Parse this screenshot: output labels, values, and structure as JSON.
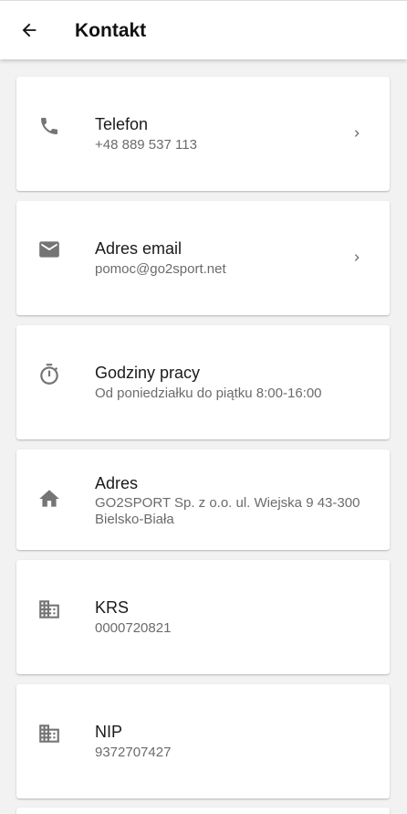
{
  "appbar": {
    "title": "Kontakt",
    "back_icon": "arrow-back-icon"
  },
  "colors": {
    "appbar_bg": "#ffffff",
    "page_bg": "#f2f2f2",
    "icon": "#757575",
    "label": "#1a1a1a",
    "secondary_text": "#6b6b6b"
  },
  "contacts": [
    {
      "label": "Telefon",
      "value": "+48 889 537 113",
      "icon": "phone-icon",
      "chevron": true
    },
    {
      "label": "Adres email",
      "value": "pomoc@go2sport.net",
      "icon": "email-icon",
      "chevron": true
    },
    {
      "label": "Godziny pracy",
      "value": "Od poniedziałku do piątku 8:00-16:00",
      "icon": "timer-icon",
      "chevron": false
    },
    {
      "label": "Adres",
      "value": "GO2SPORT Sp. z o.o. ul. Wiejska 9 43-300 Bielsko-Biała",
      "icon": "home-icon",
      "chevron": false
    },
    {
      "label": "KRS",
      "value": "0000720821",
      "icon": "business-icon",
      "chevron": false
    },
    {
      "label": "NIP",
      "value": "9372707427",
      "icon": "business-icon",
      "chevron": false
    }
  ]
}
